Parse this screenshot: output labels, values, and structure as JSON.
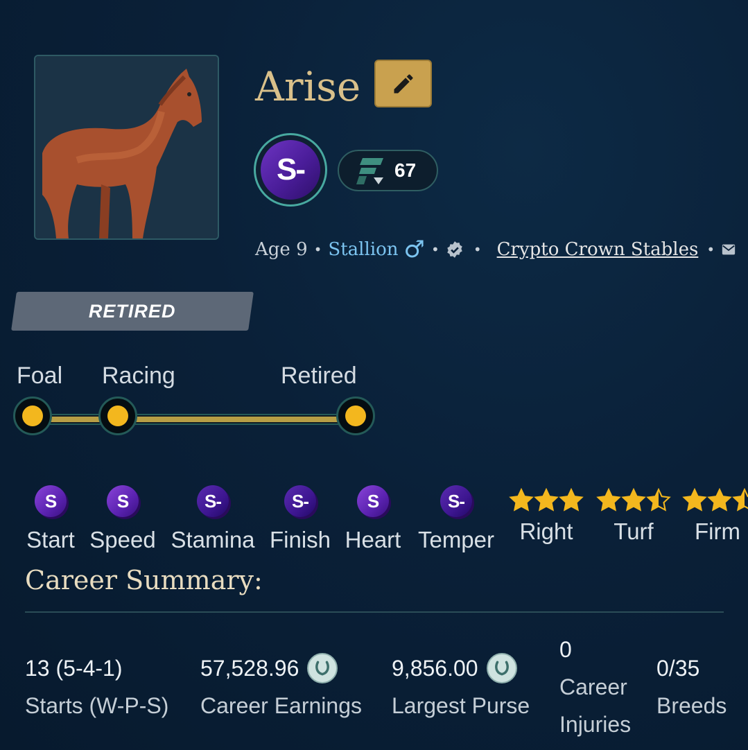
{
  "horse": {
    "name": "Arise",
    "grade": "S-",
    "form_rating": "67",
    "age": "Age 9",
    "sex": "Stallion",
    "sex_symbol": "♂",
    "owner": "Crypto Crown Stables",
    "status": "RETIRED"
  },
  "lifecycle": {
    "stages": [
      "Foal",
      "Racing",
      "Retired"
    ],
    "current_stage": "Retired"
  },
  "attributes": [
    {
      "grade": "S",
      "label": "Start"
    },
    {
      "grade": "S",
      "label": "Speed"
    },
    {
      "grade": "S-",
      "label": "Stamina"
    },
    {
      "grade": "S-",
      "label": "Finish"
    },
    {
      "grade": "S",
      "label": "Heart"
    },
    {
      "grade": "S-",
      "label": "Temper"
    }
  ],
  "preferences": [
    {
      "label": "Right",
      "stars": 3.0
    },
    {
      "label": "Turf",
      "stars": 2.5
    },
    {
      "label": "Firm",
      "stars": 2.5
    }
  ],
  "career_summary": {
    "title": "Career Summary:",
    "starts": {
      "value": "13 (5-4-1)",
      "label": "Starts (W-P-S)"
    },
    "earnings": {
      "value": "57,528.96",
      "label": "Career Earnings"
    },
    "largest_purse": {
      "value": "9,856.00",
      "label": "Largest Purse"
    },
    "injuries": {
      "value": "0",
      "label_line1": "Career",
      "label_line2": "Injuries"
    },
    "breeds": {
      "value": "0/35",
      "label": "Breeds"
    }
  },
  "icons": {
    "edit": "pencil-icon",
    "form": "form-f-icon",
    "verified": "verified-badge-icon",
    "message": "mail-icon",
    "currency": "horseshoe-coin-icon",
    "star": "star-icon"
  },
  "colors": {
    "background": "#0a2038",
    "name": "#d9c08a",
    "edit_button": "#c9a14f",
    "grade_purple": "#5a22b0",
    "link_blue": "#7cc4f0",
    "star": "#f3b71e",
    "track_fill": "#b79e45",
    "status_tag": "#5d6877"
  }
}
